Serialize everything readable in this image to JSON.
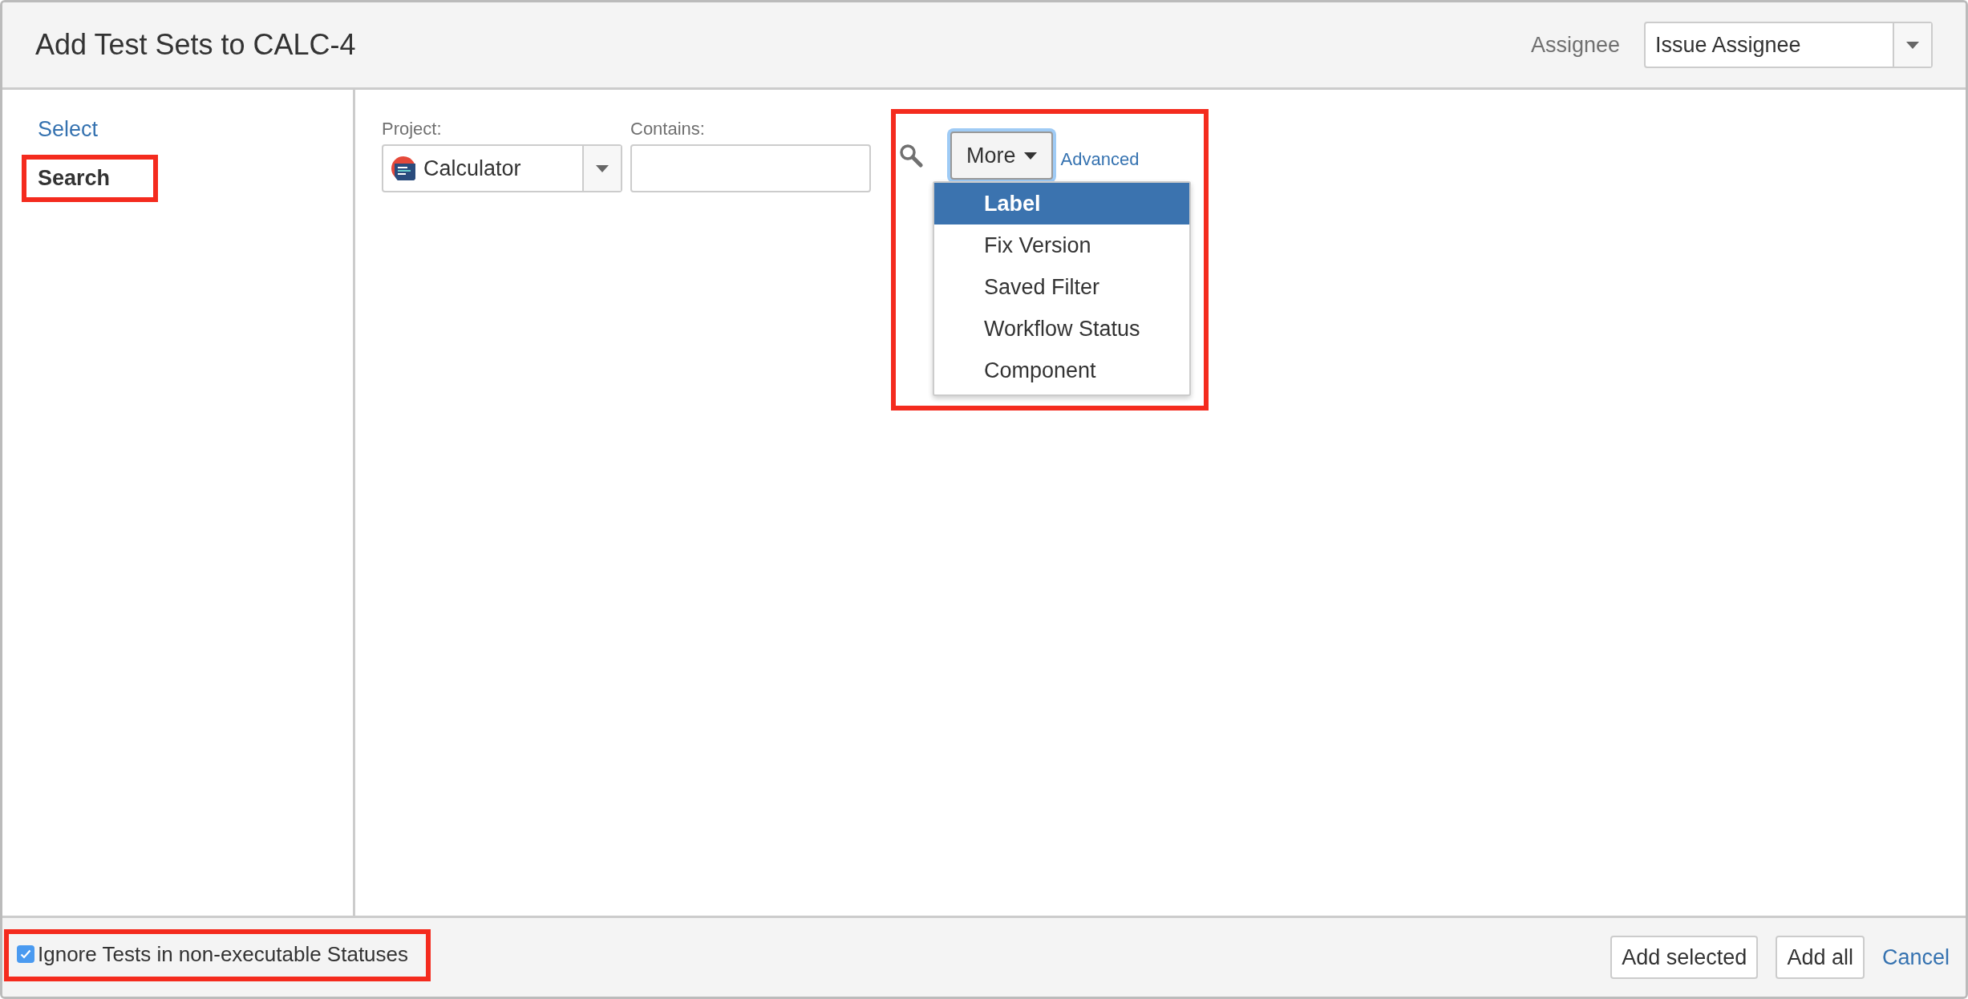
{
  "dialog": {
    "title": "Add Test Sets to CALC-4"
  },
  "assignee": {
    "label": "Assignee",
    "value": "Issue Assignee"
  },
  "sidebar": {
    "items": [
      {
        "label": "Select",
        "selected": false,
        "highlighted": false
      },
      {
        "label": "Search",
        "selected": true,
        "highlighted": true
      }
    ]
  },
  "search": {
    "project": {
      "label": "Project:",
      "value": "Calculator"
    },
    "contains": {
      "label": "Contains:"
    },
    "more_button": {
      "label": "More",
      "expanded": true,
      "highlighted": true
    },
    "advanced_link": "Advanced",
    "menu": [
      {
        "label": "Label",
        "selected": true
      },
      {
        "label": "Fix Version",
        "selected": false
      },
      {
        "label": "Saved Filter",
        "selected": false
      },
      {
        "label": "Workflow Status",
        "selected": false
      },
      {
        "label": "Component",
        "selected": false
      }
    ]
  },
  "footer": {
    "ignore_checkbox": {
      "label": "Ignore Tests in non-executable Statuses",
      "checked": true,
      "highlighted": true
    },
    "buttons": [
      {
        "label": "Add selected",
        "kind": "button"
      },
      {
        "label": "Add all",
        "kind": "button"
      },
      {
        "label": "Cancel",
        "kind": "link"
      }
    ]
  }
}
